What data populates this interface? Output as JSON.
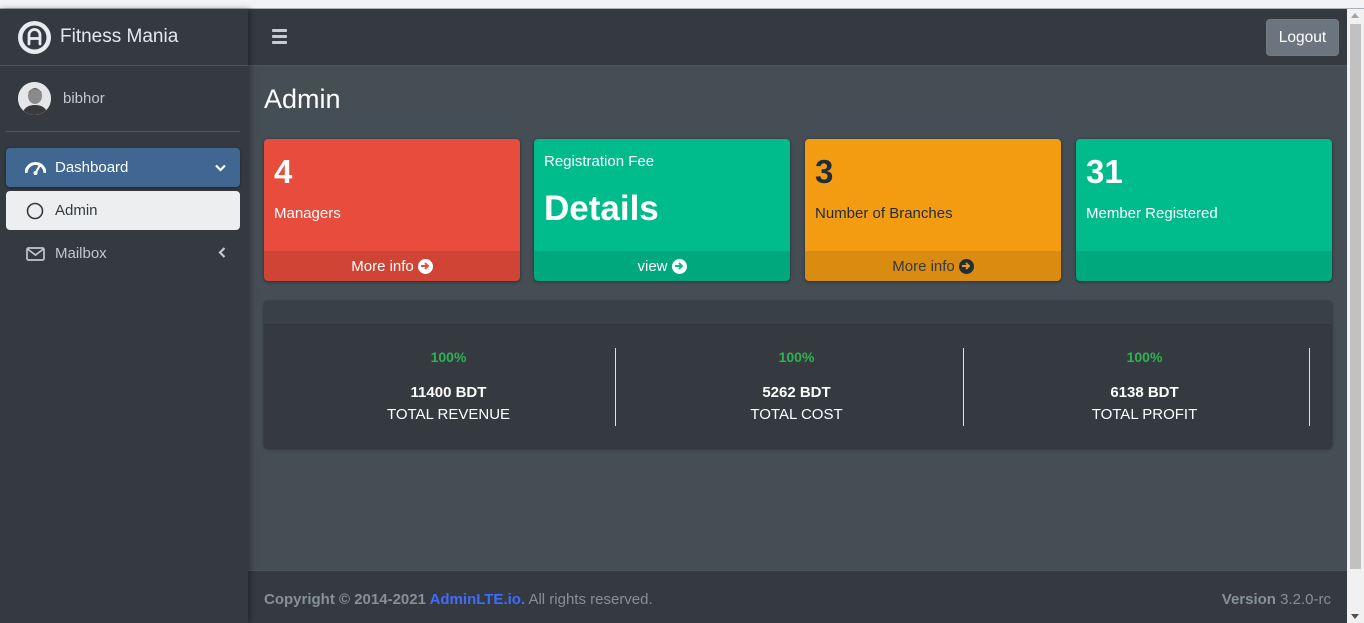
{
  "brand": {
    "name": "Fitness Mania"
  },
  "user": {
    "name": "bibhor"
  },
  "sidebar": {
    "items": [
      {
        "label": "Dashboard"
      },
      {
        "label": "Admin"
      },
      {
        "label": "Mailbox"
      }
    ]
  },
  "navbar": {
    "logout_label": "Logout"
  },
  "page": {
    "title": "Admin"
  },
  "boxes": [
    {
      "number": "4",
      "label": "Managers",
      "footer": "More info",
      "color": "#e74c3c"
    },
    {
      "label": "Registration Fee",
      "big": "Details",
      "footer": "view",
      "color": "#00bc8c"
    },
    {
      "number": "3",
      "label": "Number of Branches",
      "footer": "More info",
      "color": "#f39c12"
    },
    {
      "number": "31",
      "label": "Member Registered",
      "color": "#00bc8c"
    }
  ],
  "stats": [
    {
      "percent": "100%",
      "amount": "11400 BDT",
      "caption": "TOTAL REVENUE"
    },
    {
      "percent": "100%",
      "amount": "5262 BDT",
      "caption": "TOTAL COST"
    },
    {
      "percent": "100%",
      "amount": "6138 BDT",
      "caption": "TOTAL PROFIT"
    }
  ],
  "footer": {
    "copyright_prefix": "Copyright © 2014-2021 ",
    "link": "AdminLTE.io.",
    "suffix": " All rights reserved.",
    "version_label": "Version",
    "version": " 3.2.0-rc"
  }
}
